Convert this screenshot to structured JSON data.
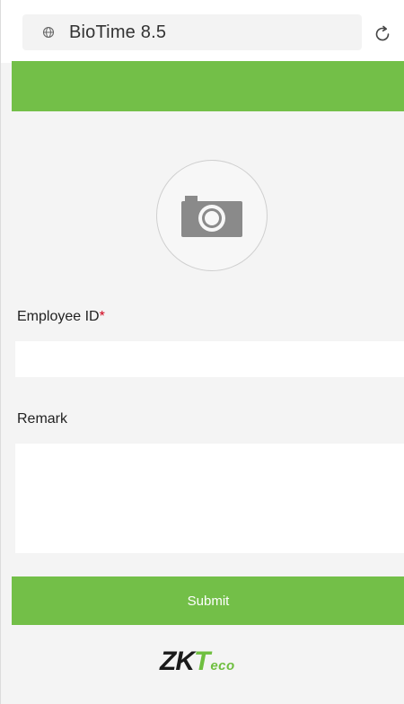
{
  "browser": {
    "url": "BioTime 8.5",
    "globe_icon": "globe-icon",
    "reload_icon": "reload-icon"
  },
  "header": {
    "color": "#73bf48"
  },
  "photo": {
    "icon": "camera-icon"
  },
  "form": {
    "employee_id_label": "Employee ID",
    "required_marker": "*",
    "employee_id_value": "",
    "remark_label": "Remark",
    "remark_value": "",
    "submit_label": "Submit"
  },
  "footer": {
    "logo_zk": "ZK",
    "logo_t": "T",
    "logo_eco": "eco"
  },
  "colors": {
    "accent": "#73bf48",
    "required": "#d0021b"
  }
}
